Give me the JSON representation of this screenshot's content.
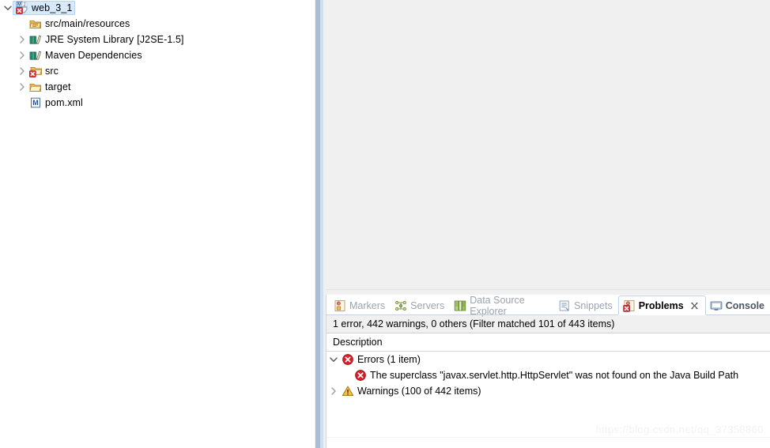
{
  "explorer": {
    "tree": [
      {
        "label": "web_3_1",
        "icon": "maven-java-project-error-icon",
        "twisty": "down",
        "indent": 0,
        "selected": true,
        "suffix": ""
      },
      {
        "label": "src/main/resources",
        "icon": "source-folder-icon",
        "twisty": "none",
        "indent": 1,
        "selected": false,
        "suffix": ""
      },
      {
        "label": "JRE System Library",
        "icon": "library-icon",
        "twisty": "right",
        "indent": 1,
        "selected": false,
        "suffix": "[J2SE-1.5]"
      },
      {
        "label": "Maven Dependencies",
        "icon": "library-icon",
        "twisty": "right",
        "indent": 1,
        "selected": false,
        "suffix": ""
      },
      {
        "label": "src",
        "icon": "folder-error-icon",
        "twisty": "right",
        "indent": 1,
        "selected": false,
        "suffix": ""
      },
      {
        "label": "target",
        "icon": "folder-icon",
        "twisty": "right",
        "indent": 1,
        "selected": false,
        "suffix": ""
      },
      {
        "label": "pom.xml",
        "icon": "maven-pom-file-icon",
        "twisty": "none",
        "indent": 1,
        "selected": false,
        "suffix": ""
      }
    ]
  },
  "panel": {
    "tabs": [
      {
        "label": "Markers",
        "icon": "markers-icon",
        "active": false,
        "style": "dim"
      },
      {
        "label": "Servers",
        "icon": "servers-icon",
        "active": false,
        "style": "dim"
      },
      {
        "label": "Data Source Explorer",
        "icon": "data-source-explorer-icon",
        "active": false,
        "style": "dim"
      },
      {
        "label": "Snippets",
        "icon": "snippets-icon",
        "active": false,
        "style": "dim"
      },
      {
        "label": "Problems",
        "icon": "problems-icon",
        "active": true,
        "style": "active"
      },
      {
        "label": "Console",
        "icon": "console-icon",
        "active": false,
        "style": "bold"
      }
    ],
    "close_label": "☒",
    "summary": "1 error, 442 warnings, 0 others (Filter matched 101 of 443 items)",
    "column_header": "Description",
    "rows": [
      {
        "label": "Errors (1 item)",
        "icon": "error-icon",
        "twisty": "down",
        "child": false
      },
      {
        "label": "The superclass \"javax.servlet.http.HttpServlet\" was not found on the Java Build Path",
        "icon": "error-icon",
        "twisty": "none",
        "child": true
      },
      {
        "label": "Warnings (100 of 442 items)",
        "icon": "warning-icon",
        "twisty": "right",
        "child": false
      }
    ]
  },
  "watermark": {
    "text": "https://blog.csdn.net/qq_37358860"
  },
  "colors": {
    "selection": "#d7e9fb",
    "sash": "#a8bdd6",
    "error_red": "#d4232a",
    "warning_yellow": "#f5c242",
    "muted_text": "#9b7f4e",
    "tab_inactive": "#9aa3ad"
  }
}
